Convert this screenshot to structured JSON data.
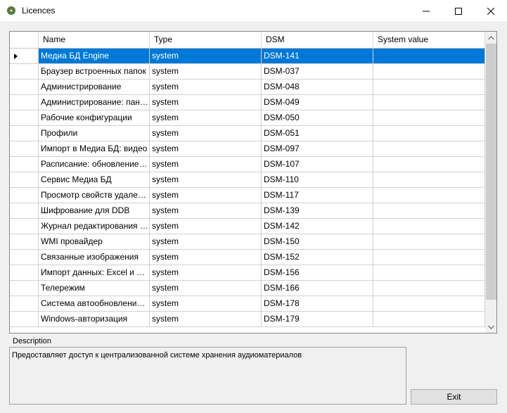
{
  "window": {
    "title": "Licences",
    "icon": "app-shield-icon"
  },
  "grid": {
    "columns": [
      "Name",
      "Type",
      "DSM",
      "System value"
    ],
    "rows": [
      {
        "name": "Медиа БД Engine",
        "type": "system",
        "dsm": "DSM-141",
        "value": "",
        "selected": true
      },
      {
        "name": "Браузер встроенных папок",
        "type": "system",
        "dsm": "DSM-037",
        "value": ""
      },
      {
        "name": "Администрирование",
        "type": "system",
        "dsm": "DSM-048",
        "value": ""
      },
      {
        "name": "Администрирование: панел...",
        "type": "system",
        "dsm": "DSM-049",
        "value": ""
      },
      {
        "name": "Рабочие конфигурации",
        "type": "system",
        "dsm": "DSM-050",
        "value": ""
      },
      {
        "name": "Профили",
        "type": "system",
        "dsm": "DSM-051",
        "value": ""
      },
      {
        "name": "Импорт в Медиа БД: видео",
        "type": "system",
        "dsm": "DSM-097",
        "value": ""
      },
      {
        "name": "Расписание: обновление и...",
        "type": "system",
        "dsm": "DSM-107",
        "value": ""
      },
      {
        "name": "Сервис Медиа БД",
        "type": "system",
        "dsm": "DSM-110",
        "value": ""
      },
      {
        "name": "Просмотр свойств удаленн...",
        "type": "system",
        "dsm": "DSM-117",
        "value": ""
      },
      {
        "name": "Шифрование для DDB",
        "type": "system",
        "dsm": "DSM-139",
        "value": ""
      },
      {
        "name": "Журнал редактирования М...",
        "type": "system",
        "dsm": "DSM-142",
        "value": ""
      },
      {
        "name": "WMI провайдер",
        "type": "system",
        "dsm": "DSM-150",
        "value": ""
      },
      {
        "name": "Связанные изображения",
        "type": "system",
        "dsm": "DSM-152",
        "value": ""
      },
      {
        "name": "Импорт данных: Excel и CSV",
        "type": "system",
        "dsm": "DSM-156",
        "value": ""
      },
      {
        "name": "Телережим",
        "type": "system",
        "dsm": "DSM-166",
        "value": ""
      },
      {
        "name": "Система автообновления ПО",
        "type": "system",
        "dsm": "DSM-178",
        "value": ""
      },
      {
        "name": "Windows-авторизация",
        "type": "system",
        "dsm": "DSM-179",
        "value": ""
      }
    ]
  },
  "description": {
    "label": "Description",
    "text": "Предоставляет доступ к централизованной системе хранения аудиоматериалов"
  },
  "buttons": {
    "exit": "Exit"
  },
  "colors": {
    "selection": "#0078d7",
    "app_icon": "#2e8b3e"
  }
}
